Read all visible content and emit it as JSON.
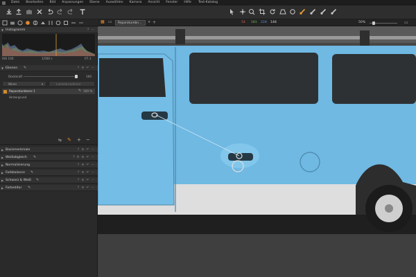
{
  "window": {
    "title": "Test-Katalog"
  },
  "menu": [
    "Datei",
    "Bearbeiten",
    "Bild",
    "Anpassungen",
    "Ebene",
    "Auswählen",
    "Kamera",
    "Ansicht",
    "Fenster",
    "Hilfe"
  ],
  "toolbar": {
    "left_icons": [
      "import-icon",
      "export-icon",
      "camera-icon",
      "delete-icon",
      "undo-icon",
      "redo-icon",
      "reset-icon",
      "text-icon"
    ],
    "right_icons": [
      "cursor-icon",
      "pan-icon",
      "loupe-icon",
      "crop-icon",
      "rotate-icon",
      "keystone-icon",
      "spot-icon",
      "brush-icon",
      "eraser-icon",
      "gradient-icon",
      "picker-icon"
    ]
  },
  "viewer": {
    "tab_name": "Reparaturebn...",
    "readout": {
      "r": "54",
      "g": "181",
      "b": "228",
      "l": "148"
    },
    "zoom": "50%",
    "colors": {
      "r": "#e05a4a",
      "g": "#6fc05a",
      "b": "#5a8fe0"
    }
  },
  "histogram": {
    "title": "Histogramm",
    "iso": "ISO 100",
    "shutter": "1/500 s",
    "aperture": "f/7.1"
  },
  "layers": {
    "title": "Ebenen",
    "opacity_label": "Deckkraft",
    "opacity_value": "100",
    "mode_value": "Wiren",
    "mode_right": "Lamelenradieren",
    "items": [
      {
        "name": "Reparaturebene 1",
        "percent": "100 %"
      },
      {
        "name": "Hintergrund",
        "percent": ""
      }
    ]
  },
  "tools": [
    {
      "label": "Basismerkmale",
      "actions": "? ≡ ↶ ⋯"
    },
    {
      "label": "Weißabgleich",
      "actions": "? A ≡ ↶ ⋯"
    },
    {
      "label": "Normalisierung",
      "actions": "? ≡ ↶ ⋯"
    },
    {
      "label": "Farbbalance",
      "actions": "? ≡ ↶ ⋯"
    },
    {
      "label": "Schwarz & Weiß",
      "actions": "? ≡ ↶ ⋯"
    },
    {
      "label": "Farbeditor",
      "actions": "? ≡ ↶ ⋯"
    }
  ]
}
